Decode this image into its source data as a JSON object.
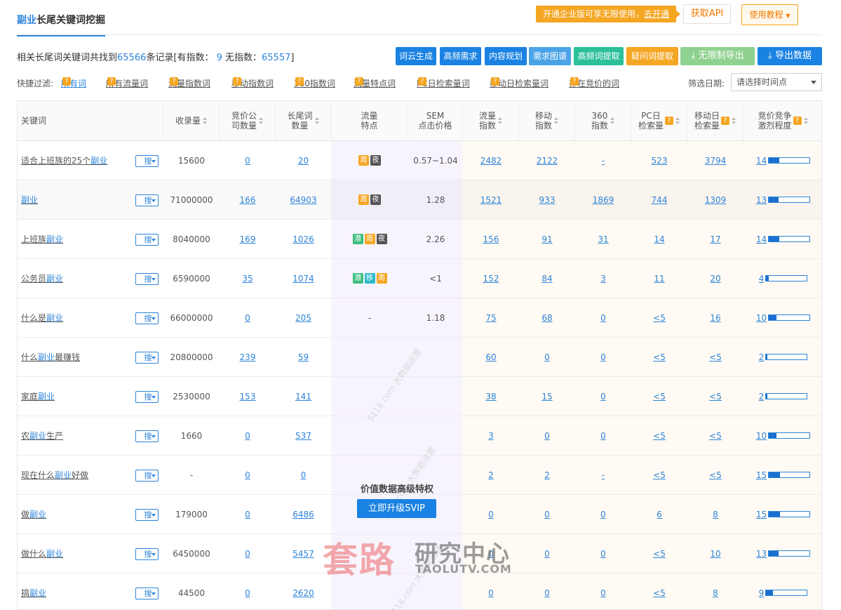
{
  "header": {
    "title_kw": "副业",
    "title_rest": "长尾关键词挖掘",
    "promo_text": "开通企业版可享无限使用，",
    "promo_link": "去开通",
    "api_label": "获取API",
    "tutorial_label": "使用教程"
  },
  "summary": {
    "prefix": "相关长尾词关键词共找到",
    "total": "65566",
    "mid1": "条记录[有指数：",
    "with_index": "9",
    "mid2": " 无指数：",
    "without_index": "65557",
    "suffix": "]"
  },
  "toolbar": [
    {
      "label": "词云生成",
      "color": "#1a82e2"
    },
    {
      "label": "高频需求",
      "color": "#1a82e2"
    },
    {
      "label": "内容规划",
      "color": "#1a82e2"
    },
    {
      "label": "需求图谱",
      "color": "#4aa3e6"
    },
    {
      "label": "高频词提取",
      "color": "#2bbf9a"
    },
    {
      "label": "疑问词提取",
      "color": "#f5a623"
    },
    {
      "label": "无限制导出",
      "color": "#8fd18f"
    },
    {
      "label": "导出数据",
      "color": "#1a82e2"
    }
  ],
  "filters": {
    "label": "快捷过滤:",
    "items": [
      "所有词",
      "所有流量词",
      "流量指数词",
      "移动指数词",
      "360指数词",
      "流量特点词",
      "PC日检索量词",
      "移动日检索量词",
      "存在竞价的词"
    ],
    "date_label": "筛选日期:",
    "date_placeholder": "请选择时间点"
  },
  "table": {
    "headers": [
      "关键词",
      "收录量",
      "竞价公\n司数量",
      "长尾词\n数量",
      "流量\n特点",
      "SEM\n点击价格",
      "流量\n指数",
      "移动\n指数",
      "360\n指数",
      "PC日\n检索量",
      "移动日\n检索量",
      "竞价竞争\n激烈程度"
    ],
    "search_btn": "搜",
    "rows": [
      {
        "kw": [
          "适合上班族的25个",
          "副业",
          ""
        ],
        "indexed": "15600",
        "companies": "0",
        "longtail": "20",
        "tags": [
          "周",
          "夜"
        ],
        "sem": "0.57~1.04",
        "flow": "2482",
        "mobile": "2122",
        "i360": "-",
        "pc_daily": "523",
        "mob_daily": "3794",
        "compete": "14",
        "compete_pct": 0.26
      },
      {
        "kw": [
          "",
          "副业",
          ""
        ],
        "indexed": "71000000",
        "companies": "166",
        "longtail": "64903",
        "tags": [
          "周",
          "夜"
        ],
        "sem": "1.28",
        "flow": "1521",
        "mobile": "933",
        "i360": "1869",
        "pc_daily": "744",
        "mob_daily": "1309",
        "compete": "13",
        "compete_pct": 0.24
      },
      {
        "kw": [
          "上班族",
          "副业",
          ""
        ],
        "indexed": "8040000",
        "companies": "169",
        "longtail": "1026",
        "tags": [
          "潜",
          "周",
          "夜"
        ],
        "sem": "2.26",
        "flow": "156",
        "mobile": "91",
        "i360": "31",
        "pc_daily": "14",
        "mob_daily": "17",
        "compete": "14",
        "compete_pct": 0.26
      },
      {
        "kw": [
          "公务员",
          "副业",
          ""
        ],
        "indexed": "6590000",
        "companies": "35",
        "longtail": "1074",
        "tags": [
          "潜",
          "移",
          "周"
        ],
        "sem": "<1",
        "flow": "152",
        "mobile": "84",
        "i360": "3",
        "pc_daily": "11",
        "mob_daily": "20",
        "compete": "4",
        "compete_pct": 0.07
      },
      {
        "kw": [
          "什么是",
          "副业",
          ""
        ],
        "indexed": "66000000",
        "companies": "0",
        "longtail": "205",
        "tags": [],
        "sem": "1.18",
        "flow": "75",
        "mobile": "68",
        "i360": "0",
        "pc_daily": "<5",
        "mob_daily": "16",
        "compete": "10",
        "compete_pct": 0.19
      },
      {
        "kw": [
          "什么",
          "副业",
          "最赚钱"
        ],
        "indexed": "20800000",
        "companies": "239",
        "longtail": "59",
        "tags": null,
        "sem": "",
        "flow": "60",
        "mobile": "0",
        "i360": "0",
        "pc_daily": "<5",
        "mob_daily": "<5",
        "compete": "2",
        "compete_pct": 0.03
      },
      {
        "kw": [
          "家庭",
          "副业",
          ""
        ],
        "indexed": "2530000",
        "companies": "153",
        "longtail": "141",
        "tags": null,
        "sem": "",
        "flow": "38",
        "mobile": "15",
        "i360": "0",
        "pc_daily": "<5",
        "mob_daily": "<5",
        "compete": "2",
        "compete_pct": 0.03
      },
      {
        "kw": [
          "农",
          "副业",
          "生产"
        ],
        "indexed": "1660",
        "companies": "0",
        "longtail": "537",
        "tags": null,
        "sem": "",
        "flow": "3",
        "mobile": "0",
        "i360": "0",
        "pc_daily": "<5",
        "mob_daily": "<5",
        "compete": "10",
        "compete_pct": 0.19
      },
      {
        "kw": [
          "现在什么",
          "副业",
          "好做"
        ],
        "indexed": "-",
        "companies": "0",
        "longtail": "0",
        "tags": null,
        "sem": "",
        "flow": "2",
        "mobile": "2",
        "i360": "-",
        "pc_daily": "<5",
        "mob_daily": "<5",
        "compete": "15",
        "compete_pct": 0.28
      },
      {
        "kw": [
          "做",
          "副业",
          ""
        ],
        "indexed": "179000",
        "companies": "0",
        "longtail": "6486",
        "tags": null,
        "sem": "",
        "flow": "0",
        "mobile": "0",
        "i360": "0",
        "pc_daily": "6",
        "mob_daily": "8",
        "compete": "15",
        "compete_pct": 0.28
      },
      {
        "kw": [
          "做什么",
          "副业",
          ""
        ],
        "indexed": "6450000",
        "companies": "0",
        "longtail": "5457",
        "tags": null,
        "sem": "",
        "flow": "0",
        "mobile": "0",
        "i360": "0",
        "pc_daily": "<5",
        "mob_daily": "10",
        "compete": "13",
        "compete_pct": 0.24
      },
      {
        "kw": [
          "搞",
          "副业",
          ""
        ],
        "indexed": "44500",
        "companies": "0",
        "longtail": "2620",
        "tags": null,
        "sem": "",
        "flow": "0",
        "mobile": "0",
        "i360": "0",
        "pc_daily": "<5",
        "mob_daily": "8",
        "compete": "9",
        "compete_pct": 0.17
      }
    ]
  },
  "premium": {
    "title": "价值数据高级特权",
    "button": "立即升级SVIP"
  },
  "watermark": {
    "big": "套路",
    "cn": "研究中心",
    "en": "TAOLUTV.COM",
    "diag": "5118.com 大数据运营"
  },
  "icons": {
    "sort": "sort-arrows-icon",
    "help": "question-mark-icon",
    "download": "download-icon",
    "dropdown": "chevron-down-icon"
  }
}
